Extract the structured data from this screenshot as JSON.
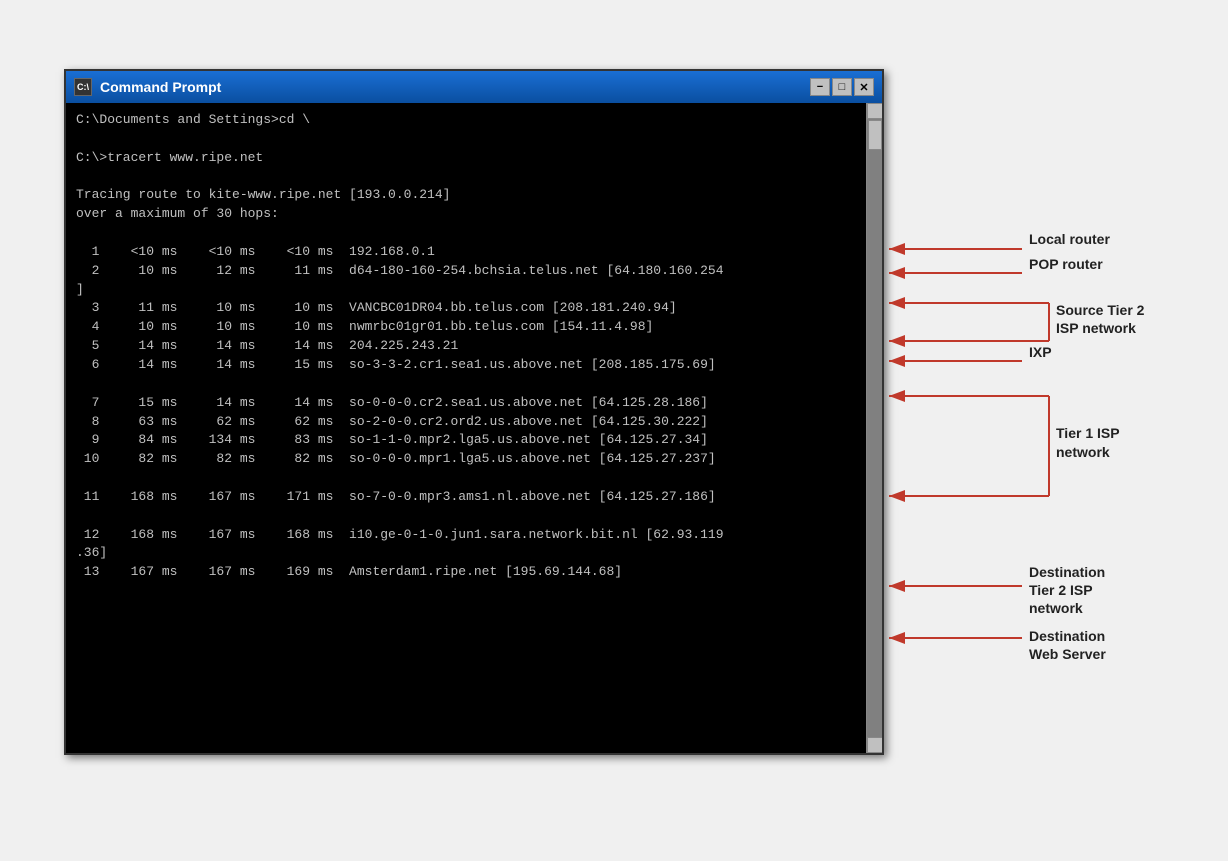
{
  "window": {
    "title": "Command Prompt",
    "icon_label": "C:\\",
    "buttons": [
      "-",
      "□",
      "✕"
    ]
  },
  "console": {
    "lines": [
      "C:\\Documents and Settings>cd \\",
      "",
      "C:\\>tracert www.ripe.net",
      "",
      "Tracing route to kite-www.ripe.net [193.0.0.214]",
      "over a maximum of 30 hops:",
      "",
      "  1    <10 ms    <10 ms    <10 ms  192.168.0.1",
      "  2     10 ms     12 ms     11 ms  d64-180-160-254.bchsia.telus.net [64.180.160.254",
      "]",
      "  3     11 ms     10 ms     10 ms  VANCBC01DR04.bb.telus.com [208.181.240.94]",
      "  4     10 ms     10 ms     10 ms  nwmrbc01gr01.bb.telus.com [154.11.4.98]",
      "  5     14 ms     14 ms     14 ms  204.225.243.21",
      "  6     14 ms     14 ms     15 ms  so-3-3-2.cr1.sea1.us.above.net [208.185.175.69]",
      "",
      "  7     15 ms     14 ms     14 ms  so-0-0-0.cr2.sea1.us.above.net [64.125.28.186]",
      "  8     63 ms     62 ms     62 ms  so-2-0-0.cr2.ord2.us.above.net [64.125.30.222]",
      "  9     84 ms    134 ms     83 ms  so-1-1-0.mpr2.lga5.us.above.net [64.125.27.34]",
      " 10     82 ms     82 ms     82 ms  so-0-0-0.mpr1.lga5.us.above.net [64.125.27.237]",
      "",
      " 11    168 ms    167 ms    171 ms  so-7-0-0.mpr3.ams1.nl.above.net [64.125.27.186]",
      "",
      " 12    168 ms    167 ms    168 ms  i10.ge-0-1-0.jun1.sara.network.bit.nl [62.93.119",
      ".36]",
      " 13    167 ms    167 ms    169 ms  Amsterdam1.ripe.net [195.69.144.68]"
    ]
  },
  "annotations": {
    "local_router": "Local router",
    "pop_router": "POP router",
    "source_tier2": "Source Tier 2\nISP network",
    "ixp": "IXP",
    "tier1_isp": "Tier 1 ISP\nnetwork",
    "dest_tier2": "Destination\nTier 2 ISP\nnetwork",
    "dest_web": "Destination\nWeb Server"
  }
}
